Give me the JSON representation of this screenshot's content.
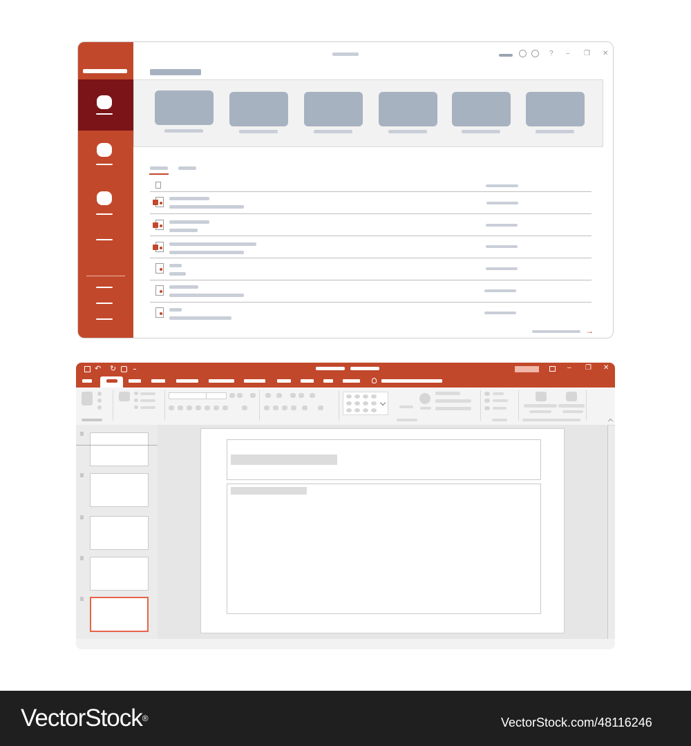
{
  "colors": {
    "brand": "#c2482b",
    "brand_dark": "#7a1418",
    "placeholder": "#c9ced8",
    "thumbnail": "#a7b2c1",
    "selection": "#e8634a"
  },
  "icons": {
    "window_min": "–",
    "window_restore": "❐",
    "window_close": "✕",
    "help": "?",
    "arrow": "→",
    "undo": "↶",
    "redo": "↻",
    "lightbulb": "💡",
    "save": "▣"
  },
  "editor": {
    "slide_count": 5,
    "selected_slide": 5
  },
  "footer": {
    "brand": "VectorStock",
    "registered": "®",
    "site_url": "VectorStock.com/48116246"
  }
}
